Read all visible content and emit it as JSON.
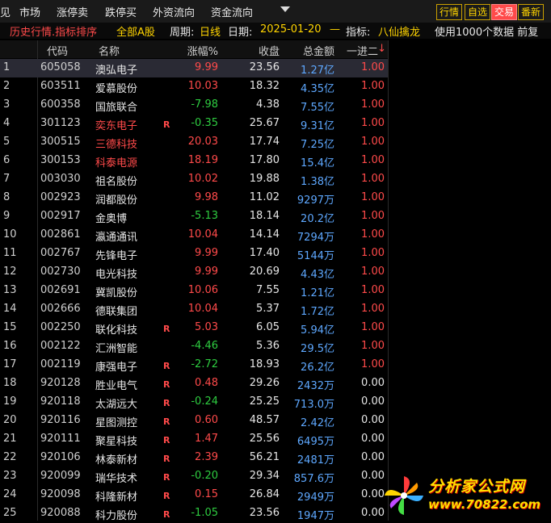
{
  "menubar": {
    "items": [
      "见",
      "市场",
      "涨停卖",
      "跌停买",
      "外资流向",
      "资金流向"
    ],
    "right_buttons": [
      {
        "label": "行情",
        "active": false
      },
      {
        "label": "自选",
        "active": false
      },
      {
        "label": "交易",
        "active": true
      },
      {
        "label": "番新",
        "active": false
      }
    ]
  },
  "infobar": {
    "mode": "历史行情.指标排序",
    "market": "全部A股",
    "period_label": "周期:",
    "period": "日线",
    "date_label": "日期:",
    "date": "2025-01-20",
    "dash": "—",
    "indicator_label": "指标:",
    "indicator": "八仙擒龙",
    "note": "使用1000个数据 前复"
  },
  "table": {
    "headers": {
      "code": "代码",
      "name": "名称",
      "pct": "涨幅%",
      "close": "收盘",
      "amount": "总金额",
      "lb": "一进二"
    },
    "sort_indicator": "↓",
    "rows": [
      {
        "i": "1",
        "code": "605058",
        "name": "澳弘电子",
        "flag": "",
        "pct": "9.99",
        "close": "23.56",
        "amount": "1.27亿",
        "lb": "1.00",
        "dir": "up",
        "nameRed": false,
        "lbRed": true
      },
      {
        "i": "2",
        "code": "603511",
        "name": "爱慕股份",
        "flag": "",
        "pct": "10.03",
        "close": "18.32",
        "amount": "4.35亿",
        "lb": "1.00",
        "dir": "up",
        "nameRed": false,
        "lbRed": true
      },
      {
        "i": "3",
        "code": "600358",
        "name": "国旅联合",
        "flag": "",
        "pct": "-7.98",
        "close": "4.38",
        "amount": "7.55亿",
        "lb": "1.00",
        "dir": "dn",
        "nameRed": false,
        "lbRed": true
      },
      {
        "i": "4",
        "code": "301123",
        "name": "奕东电子",
        "flag": "R",
        "pct": "-0.35",
        "close": "25.67",
        "amount": "9.31亿",
        "lb": "1.00",
        "dir": "dn",
        "nameRed": true,
        "lbRed": true
      },
      {
        "i": "5",
        "code": "300515",
        "name": "三德科技",
        "flag": "",
        "pct": "20.03",
        "close": "17.74",
        "amount": "7.25亿",
        "lb": "1.00",
        "dir": "up",
        "nameRed": true,
        "lbRed": true
      },
      {
        "i": "6",
        "code": "300153",
        "name": "科泰电源",
        "flag": "",
        "pct": "18.19",
        "close": "17.80",
        "amount": "15.4亿",
        "lb": "1.00",
        "dir": "up",
        "nameRed": true,
        "lbRed": true
      },
      {
        "i": "7",
        "code": "003030",
        "name": "祖名股份",
        "flag": "",
        "pct": "10.02",
        "close": "19.88",
        "amount": "1.38亿",
        "lb": "1.00",
        "dir": "up",
        "nameRed": false,
        "lbRed": true
      },
      {
        "i": "8",
        "code": "002923",
        "name": "润都股份",
        "flag": "",
        "pct": "9.98",
        "close": "11.02",
        "amount": "9297万",
        "lb": "1.00",
        "dir": "up",
        "nameRed": false,
        "lbRed": true
      },
      {
        "i": "9",
        "code": "002917",
        "name": "金奥博",
        "flag": "",
        "pct": "-5.13",
        "close": "18.14",
        "amount": "20.2亿",
        "lb": "1.00",
        "dir": "dn",
        "nameRed": false,
        "lbRed": true
      },
      {
        "i": "10",
        "code": "002861",
        "name": "瀛通通讯",
        "flag": "",
        "pct": "10.04",
        "close": "14.14",
        "amount": "7294万",
        "lb": "1.00",
        "dir": "up",
        "nameRed": false,
        "lbRed": true
      },
      {
        "i": "11",
        "code": "002767",
        "name": "先锋电子",
        "flag": "",
        "pct": "9.99",
        "close": "17.40",
        "amount": "5144万",
        "lb": "1.00",
        "dir": "up",
        "nameRed": false,
        "lbRed": true
      },
      {
        "i": "12",
        "code": "002730",
        "name": "电光科技",
        "flag": "",
        "pct": "9.99",
        "close": "20.69",
        "amount": "4.43亿",
        "lb": "1.00",
        "dir": "up",
        "nameRed": false,
        "lbRed": true
      },
      {
        "i": "13",
        "code": "002691",
        "name": "冀凯股份",
        "flag": "",
        "pct": "10.06",
        "close": "7.55",
        "amount": "1.21亿",
        "lb": "1.00",
        "dir": "up",
        "nameRed": false,
        "lbRed": true
      },
      {
        "i": "14",
        "code": "002666",
        "name": "德联集团",
        "flag": "",
        "pct": "10.04",
        "close": "5.37",
        "amount": "1.72亿",
        "lb": "1.00",
        "dir": "up",
        "nameRed": false,
        "lbRed": true
      },
      {
        "i": "15",
        "code": "002250",
        "name": "联化科技",
        "flag": "R",
        "pct": "5.03",
        "close": "6.05",
        "amount": "5.94亿",
        "lb": "1.00",
        "dir": "up",
        "nameRed": false,
        "lbRed": true
      },
      {
        "i": "16",
        "code": "002122",
        "name": "汇洲智能",
        "flag": "",
        "pct": "-4.46",
        "close": "5.36",
        "amount": "29.5亿",
        "lb": "1.00",
        "dir": "dn",
        "nameRed": false,
        "lbRed": true
      },
      {
        "i": "17",
        "code": "002119",
        "name": "康强电子",
        "flag": "R",
        "pct": "-2.72",
        "close": "18.93",
        "amount": "26.2亿",
        "lb": "1.00",
        "dir": "dn",
        "nameRed": false,
        "lbRed": true
      },
      {
        "i": "18",
        "code": "920128",
        "name": "胜业电气",
        "flag": "R",
        "pct": "0.48",
        "close": "29.26",
        "amount": "2432万",
        "lb": "0.00",
        "dir": "up",
        "nameRed": false,
        "lbRed": false
      },
      {
        "i": "19",
        "code": "920118",
        "name": "太湖远大",
        "flag": "R",
        "pct": "-0.24",
        "close": "25.25",
        "amount": "713.0万",
        "lb": "0.00",
        "dir": "dn",
        "nameRed": false,
        "lbRed": false
      },
      {
        "i": "20",
        "code": "920116",
        "name": "星图测控",
        "flag": "R",
        "pct": "0.60",
        "close": "48.57",
        "amount": "2.42亿",
        "lb": "0.00",
        "dir": "up",
        "nameRed": false,
        "lbRed": false
      },
      {
        "i": "21",
        "code": "920111",
        "name": "聚星科技",
        "flag": "R",
        "pct": "1.47",
        "close": "25.56",
        "amount": "6495万",
        "lb": "0.00",
        "dir": "up",
        "nameRed": false,
        "lbRed": false
      },
      {
        "i": "22",
        "code": "920106",
        "name": "林泰新材",
        "flag": "R",
        "pct": "2.39",
        "close": "56.21",
        "amount": "2481万",
        "lb": "0.00",
        "dir": "up",
        "nameRed": false,
        "lbRed": false
      },
      {
        "i": "23",
        "code": "920099",
        "name": "瑞华技术",
        "flag": "R",
        "pct": "-0.20",
        "close": "29.34",
        "amount": "857.6万",
        "lb": "0.00",
        "dir": "dn",
        "nameRed": false,
        "lbRed": false
      },
      {
        "i": "24",
        "code": "920098",
        "name": "科隆新材",
        "flag": "R",
        "pct": "0.15",
        "close": "26.84",
        "amount": "2949万",
        "lb": "0.00",
        "dir": "up",
        "nameRed": false,
        "lbRed": false
      },
      {
        "i": "25",
        "code": "920088",
        "name": "科力股份",
        "flag": "R",
        "pct": "-1.05",
        "close": "23.56",
        "amount": "1947万",
        "lb": "0.00",
        "dir": "dn",
        "nameRed": false,
        "lbRed": false
      }
    ]
  },
  "watermark": {
    "title": "分析家公式网",
    "url": "www.70822.com"
  },
  "colors": {
    "up": "#ff4a4a",
    "down": "#2ecc40",
    "amount": "#5ea8ff",
    "accent": "#ffd400"
  }
}
